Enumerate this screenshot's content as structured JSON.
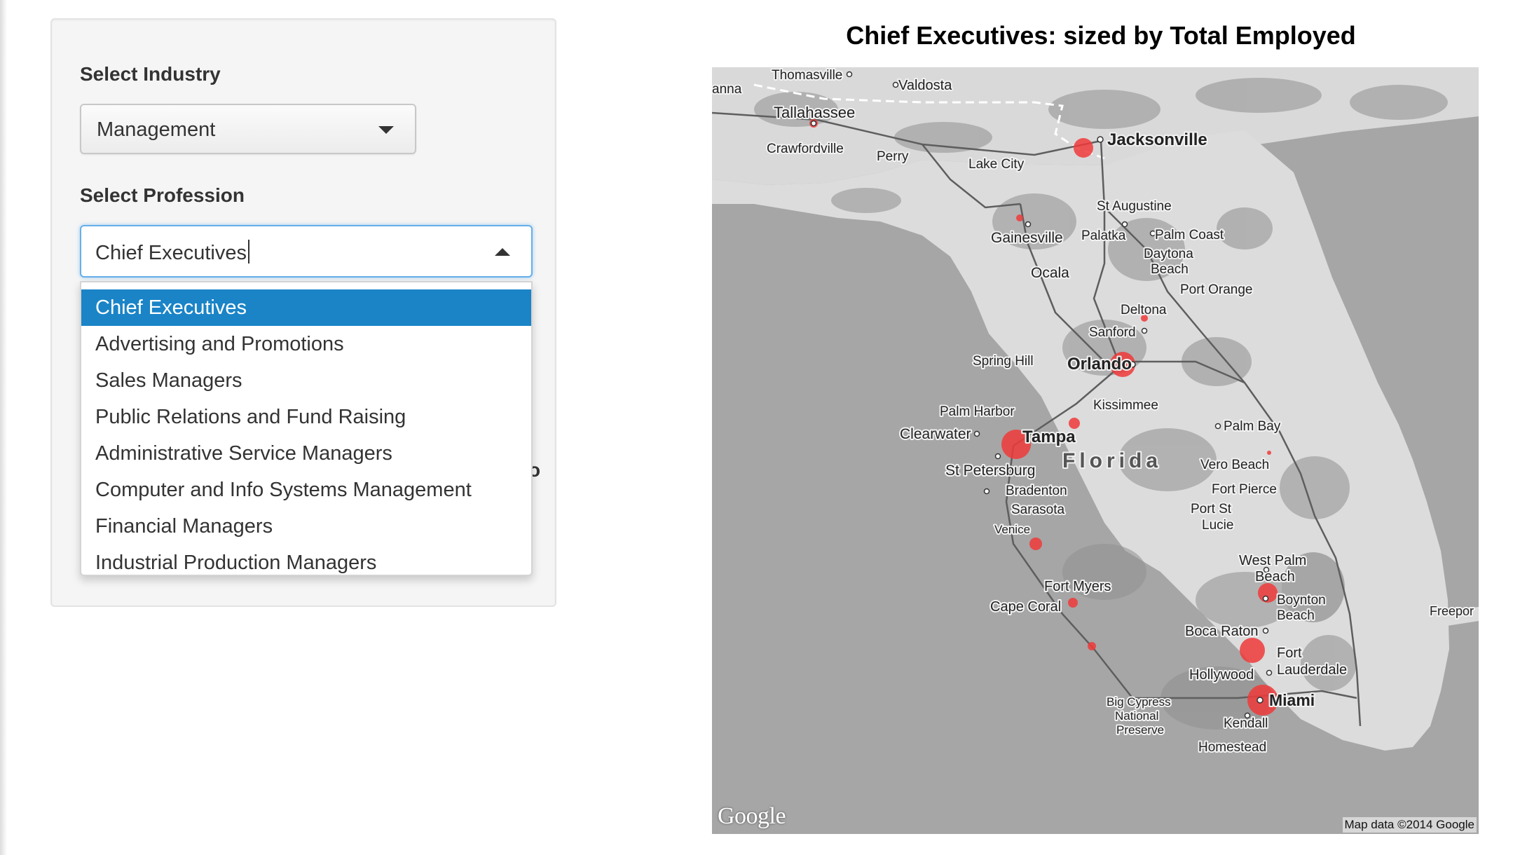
{
  "sidebar": {
    "industry_label": "Select Industry",
    "industry_value": "Management",
    "profession_label": "Select Profession",
    "profession_value": "Chief Executives",
    "hidden_fragment": "o",
    "profession_options": [
      "Chief Executives",
      "Advertising and Promotions",
      "Sales Managers",
      "Public Relations and Fund Raising",
      "Administrative Service Managers",
      "Computer and Info Systems Management",
      "Financial Managers",
      "Industrial Production Managers"
    ],
    "active_option_index": 0
  },
  "map": {
    "title": "Chief Executives: sized by Total Employed",
    "logo": "Google",
    "attribution": "Map data ©2014 Google",
    "marker_color": "#f03a3a",
    "place_labels": {
      "thomasville": "Thomasville",
      "anna": "anna",
      "valdosta": "Valdosta",
      "tallahassee": "Tallahassee",
      "crawfordville": "Crawfordville",
      "perry": "Perry",
      "lake_city": "Lake City",
      "jacksonville": "Jacksonville",
      "st_augustine": "St Augustine",
      "gainesville": "Gainesville",
      "palatka": "Palatka",
      "palm_coast": "Palm Coast",
      "daytona_1": "Daytona",
      "daytona_2": "Beach",
      "ocala": "Ocala",
      "port_orange": "Port Orange",
      "deltona": "Deltona",
      "sanford": "Sanford",
      "spring_hill": "Spring Hill",
      "orlando": "Orlando",
      "kissimmee": "Kissimmee",
      "palm_harbor": "Palm Harbor",
      "clearwater": "Clearwater",
      "tampa": "Tampa",
      "palm_bay": "Palm Bay",
      "florida": "Florida",
      "vero_beach": "Vero Beach",
      "st_petersburg": "St Petersburg",
      "bradenton": "Bradenton",
      "fort_pierce": "Fort Pierce",
      "sarasota": "Sarasota",
      "port_st_lucie_1": "Port St",
      "port_st_lucie_2": "Lucie",
      "venice": "Venice",
      "west_palm_1": "West Palm",
      "west_palm_2": "Beach",
      "fort_myers": "Fort Myers",
      "boynton_1": "Boynton",
      "boynton_2": "Beach",
      "freeport": "Freepor",
      "cape_coral": "Cape Coral",
      "boca_raton": "Boca Raton",
      "fort_lauderdale_1": "Fort",
      "fort_lauderdale_2": "Lauderdale",
      "hollywood": "Hollywood",
      "miami": "Miami",
      "big_cypress_1": "Big Cypress",
      "big_cypress_2": "National",
      "big_cypress_3": "Preserve",
      "kendall": "Kendall",
      "homestead": "Homestead"
    }
  }
}
